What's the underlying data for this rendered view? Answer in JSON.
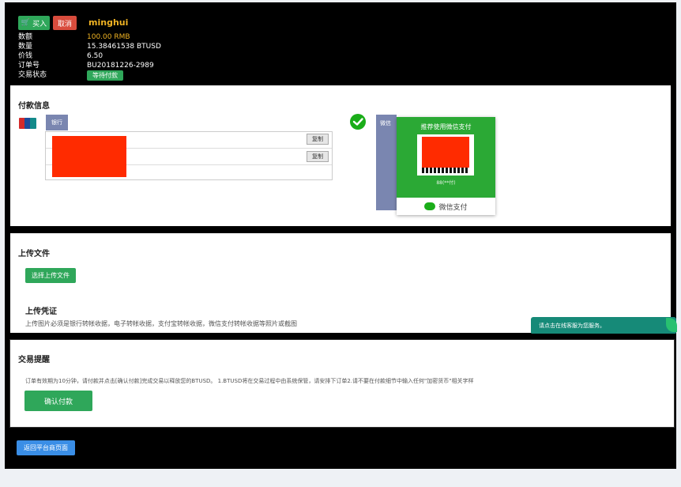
{
  "order": {
    "buy_label": "买入",
    "cancel_label": "取消",
    "username": "minghui",
    "rows": [
      {
        "label": "数额",
        "value": "100.00 RMB"
      },
      {
        "label": "数量",
        "value": "15.38461538 BTUSD"
      },
      {
        "label": "价钱",
        "value": "6.50"
      },
      {
        "label": "订单号",
        "value": "BU20181226-2989"
      },
      {
        "label": "交易状态",
        "value": "等待付款"
      }
    ],
    "amount_color": "#f0b323"
  },
  "payment": {
    "title": "付款信息",
    "bank_tab": "银行",
    "copy_label": "复制",
    "wechat_tab": "微信",
    "wechat_recommend": "推荐使用微信支付",
    "wechat_qr_caption": "88(**付)",
    "wechat_pay_label": "微信支付"
  },
  "upload": {
    "section_title": "上传文件",
    "choose_button": "选择上传文件",
    "voucher_title": "上传凭证",
    "voucher_hint": "上传图片必须是银行转帐收据，电子转帐收据，支付宝转帐收据，微信支付转帐收据等照片或截图"
  },
  "chat_bubble": "请点击在线客服为您服务。",
  "reminder": {
    "title": "交易提醒",
    "text": "订单有效期为10分钟，请付款并点击[确认付款]完成交易以释放您的BTUSD。 1.BTUSD将在交易过程中由系统保管，请安排下订单2.请不要在付款细节中输入任何\"加密货币\"相关字样",
    "confirm_button": "确认付款"
  },
  "footer": {
    "back_button": "返回平台商页面"
  }
}
